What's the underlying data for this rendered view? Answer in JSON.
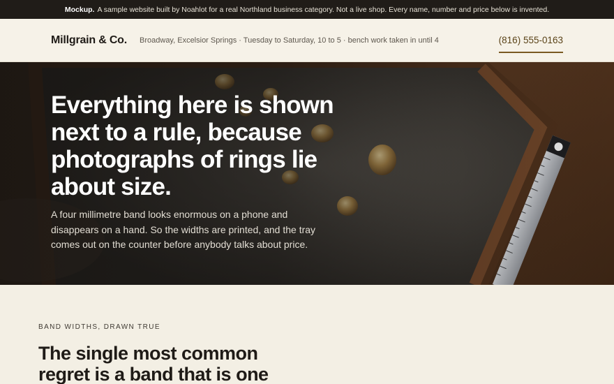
{
  "notice": {
    "lead": "Mockup.",
    "text": "A sample website built by Noahlot for a real Northland business category. Not a live shop. Every name, number and price below is invented."
  },
  "header": {
    "brand": "Millgrain & Co.",
    "meta": "Broadway, Excelsior Springs · Tuesday to Saturday, 10 to 5 · bench work taken in until 4",
    "phone": "(816) 555-0163"
  },
  "hero": {
    "title": "Everything here is shown next to a rule, because photographs of rings lie about size.",
    "subtitle": "A four millimetre band looks enormous on a phone and disappears on a hand. So the widths are printed, and the tray comes out on the counter before anybody talks about price."
  },
  "section": {
    "eyebrow": "BAND WIDTHS, DRAWN TRUE",
    "title": "The single most common regret is a band that is one"
  }
}
